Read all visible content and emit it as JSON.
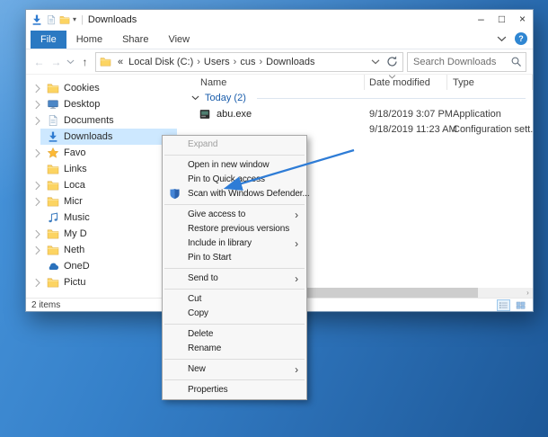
{
  "window": {
    "title": "Downloads",
    "controls": {
      "minimize": "–",
      "maximize": "□",
      "close": "×"
    }
  },
  "ribbon": {
    "tabs": [
      {
        "label": "File",
        "active": true
      },
      {
        "label": "Home",
        "active": false
      },
      {
        "label": "Share",
        "active": false
      },
      {
        "label": "View",
        "active": false
      }
    ],
    "help_label": "?"
  },
  "address_bar": {
    "collapsed_marker": "«",
    "crumbs": [
      "Local Disk (C:)",
      "Users",
      "cus",
      "Downloads"
    ],
    "separator": "›",
    "search_placeholder": "Search Downloads"
  },
  "sidebar": {
    "items": [
      {
        "label": "Cookies",
        "icon": "folder",
        "chevron": true,
        "selected": false
      },
      {
        "label": "Desktop",
        "icon": "monitor",
        "chevron": true,
        "selected": false
      },
      {
        "label": "Documents",
        "icon": "document",
        "chevron": true,
        "selected": false
      },
      {
        "label": "Downloads",
        "icon": "download-arrow",
        "chevron": false,
        "selected": true
      },
      {
        "label": "Favo",
        "icon": "star",
        "chevron": true,
        "selected": false
      },
      {
        "label": "Links",
        "icon": "folder",
        "chevron": false,
        "selected": false
      },
      {
        "label": "Loca",
        "icon": "folder",
        "chevron": true,
        "selected": false
      },
      {
        "label": "Micr",
        "icon": "folder",
        "chevron": true,
        "selected": false
      },
      {
        "label": "Music",
        "icon": "music-note",
        "chevron": false,
        "selected": false
      },
      {
        "label": "My D",
        "icon": "folder",
        "chevron": true,
        "selected": false
      },
      {
        "label": "Neth",
        "icon": "folder",
        "chevron": true,
        "selected": false
      },
      {
        "label": "OneD",
        "icon": "cloud",
        "chevron": false,
        "selected": false
      },
      {
        "label": "Pictu",
        "icon": "folder",
        "chevron": true,
        "selected": false
      }
    ]
  },
  "file_list": {
    "columns": [
      "Name",
      "Date modified",
      "Type"
    ],
    "sorted_column": "Date modified",
    "group_label": "Today (2)",
    "rows": [
      {
        "name": "abu.exe",
        "icon": "exe",
        "date_modified": "9/18/2019 3:07 PM",
        "type": "Application"
      },
      {
        "name": "",
        "icon": "",
        "date_modified": "9/18/2019 11:23 AM",
        "type": "Configuration sett..."
      }
    ]
  },
  "status_bar": {
    "items_count": "2 items"
  },
  "context_menu": {
    "items": [
      {
        "label": "Expand",
        "disabled": true
      },
      {
        "separator": true
      },
      {
        "label": "Open in new window"
      },
      {
        "label": "Pin to Quick access"
      },
      {
        "label": "Scan with Windows Defender...",
        "icon": "defender-shield"
      },
      {
        "separator": true
      },
      {
        "label": "Give access to",
        "submenu": true
      },
      {
        "label": "Restore previous versions"
      },
      {
        "label": "Include in library",
        "submenu": true
      },
      {
        "label": "Pin to Start"
      },
      {
        "separator": true
      },
      {
        "label": "Send to",
        "submenu": true
      },
      {
        "separator": true
      },
      {
        "label": "Cut"
      },
      {
        "label": "Copy"
      },
      {
        "separator": true
      },
      {
        "label": "Delete"
      },
      {
        "label": "Rename"
      },
      {
        "separator": true
      },
      {
        "label": "New",
        "submenu": true
      },
      {
        "separator": true
      },
      {
        "label": "Properties"
      }
    ],
    "submenu_arrow": "›"
  },
  "annotation": {
    "arrow_color": "#2e7cd6"
  },
  "colors": {
    "accent_blue": "#2b79c2",
    "selection_blue": "#cde8ff",
    "desktop_top": "#4a97dd",
    "desktop_bottom": "#1d5898"
  }
}
